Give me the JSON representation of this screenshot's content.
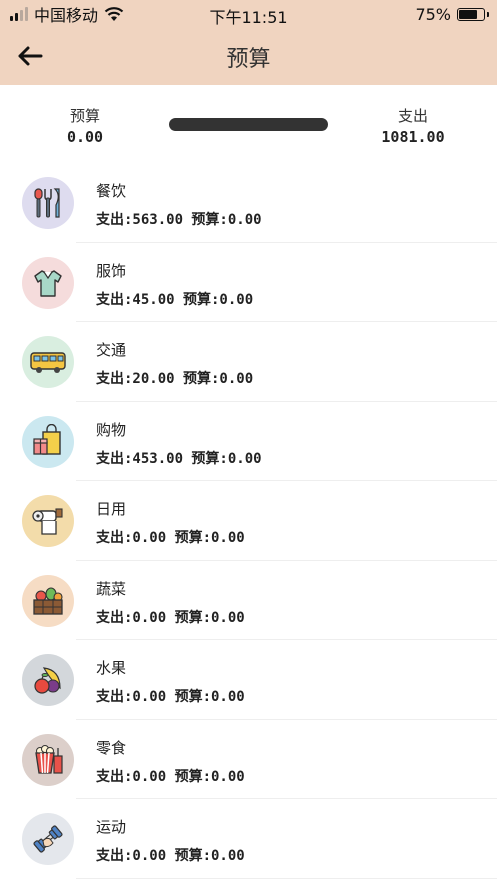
{
  "status_bar": {
    "carrier": "中国移动",
    "time": "下午11:51",
    "battery_percent": "75%",
    "battery_level": 0.75
  },
  "nav": {
    "title": "预算"
  },
  "summary": {
    "budget_label": "预算",
    "budget_value": "0.00",
    "spend_label": "支出",
    "spend_value": "1081.00",
    "progress": 1.0
  },
  "categories": [
    {
      "name": "餐饮",
      "detail": "支出:563.00 预算:0.00",
      "icon": "cutlery-icon",
      "bg": "#dedcef"
    },
    {
      "name": "服饰",
      "detail": "支出:45.00 预算:0.00",
      "icon": "shirt-icon",
      "bg": "#f5dcdc"
    },
    {
      "name": "交通",
      "detail": "支出:20.00 预算:0.00",
      "icon": "bus-icon",
      "bg": "#d9eee0"
    },
    {
      "name": "购物",
      "detail": "支出:453.00 预算:0.00",
      "icon": "shopping-bag-icon",
      "bg": "#cbe8f0"
    },
    {
      "name": "日用",
      "detail": "支出:0.00 预算:0.00",
      "icon": "toilet-paper-icon",
      "bg": "#f3dcaa"
    },
    {
      "name": "蔬菜",
      "detail": "支出:0.00 预算:0.00",
      "icon": "vegetable-basket-icon",
      "bg": "#f6dcc4"
    },
    {
      "name": "水果",
      "detail": "支出:0.00 预算:0.00",
      "icon": "fruit-icon",
      "bg": "#d3d7db"
    },
    {
      "name": "零食",
      "detail": "支出:0.00 预算:0.00",
      "icon": "popcorn-icon",
      "bg": "#dccfca"
    },
    {
      "name": "运动",
      "detail": "支出:0.00 预算:0.00",
      "icon": "dumbbell-icon",
      "bg": "#e4e7ec"
    }
  ]
}
